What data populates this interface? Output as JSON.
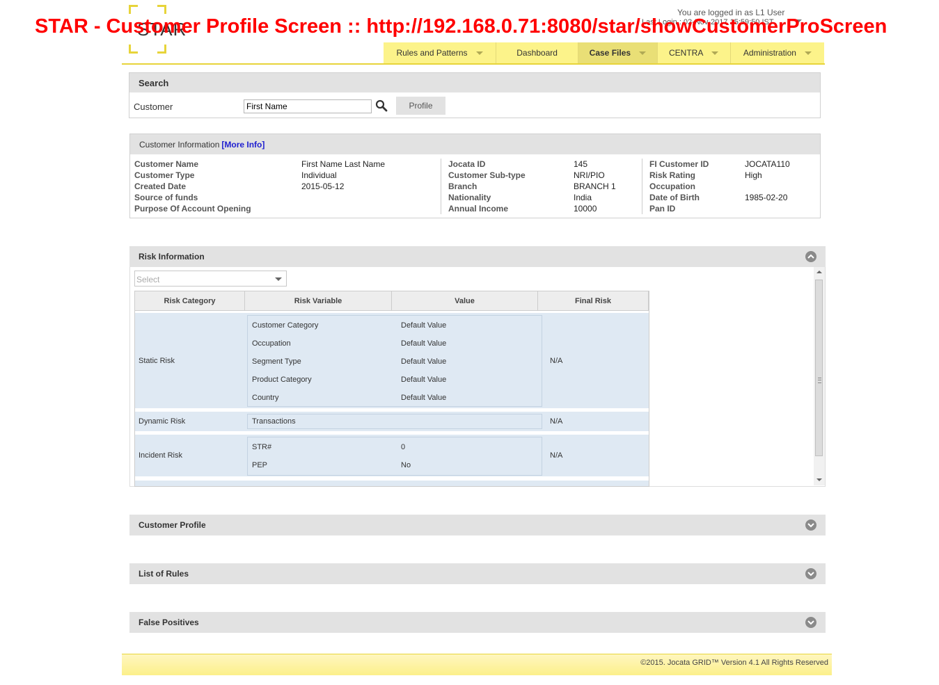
{
  "banner": "STAR - Customer Profile Screen :: http://192.168.0.71:8080/star/showCustomerProScreen",
  "logo_text": "STAR",
  "user": {
    "logged_in": "You are logged in as L1 User",
    "last_login": "Last Login : 02-Nov-2017 15:59:50 IST"
  },
  "nav": {
    "tabs": [
      {
        "label": "Rules and Patterns",
        "has_dropdown": true,
        "active": false
      },
      {
        "label": "Dashboard",
        "has_dropdown": false,
        "active": false
      },
      {
        "label": "Case Files",
        "has_dropdown": true,
        "active": true
      },
      {
        "label": "CENTRA",
        "has_dropdown": true,
        "active": false
      },
      {
        "label": "Administration",
        "has_dropdown": true,
        "active": false
      }
    ]
  },
  "search": {
    "title": "Search",
    "customer_label": "Customer",
    "input_value": "First Name",
    "profile_button": "Profile"
  },
  "customer_info": {
    "title": "Customer Information",
    "more_info": "[More Info]",
    "col1": [
      {
        "label": "Customer Name",
        "value": "First Name Last Name"
      },
      {
        "label": "Customer Type",
        "value": "Individual"
      },
      {
        "label": "Created Date",
        "value": "2015-05-12"
      },
      {
        "label": "Source of funds",
        "value": ""
      },
      {
        "label": "Purpose Of Account Opening",
        "value": ""
      }
    ],
    "col2": [
      {
        "label": "Jocata ID",
        "value": "145"
      },
      {
        "label": "Customer Sub-type",
        "value": "NRI/PIO"
      },
      {
        "label": "Branch",
        "value": "BRANCH 1"
      },
      {
        "label": "Nationality",
        "value": "India"
      },
      {
        "label": "Annual Income",
        "value": "10000"
      }
    ],
    "col3": [
      {
        "label": "FI Customer ID",
        "value": "JOCATA110"
      },
      {
        "label": "Risk Rating",
        "value": "High"
      },
      {
        "label": "Occupation",
        "value": ""
      },
      {
        "label": "Date of Birth",
        "value": "1985-02-20"
      },
      {
        "label": "Pan ID",
        "value": ""
      }
    ]
  },
  "risk": {
    "title": "Risk Information",
    "select_placeholder": "Select",
    "headers": [
      "Risk Category",
      "Risk Variable",
      "Value",
      "Final Risk"
    ],
    "static": {
      "category": "Static Risk",
      "final": "N/A",
      "rows": [
        {
          "variable": "Customer Category",
          "value": "Default Value"
        },
        {
          "variable": "Occupation",
          "value": "Default Value"
        },
        {
          "variable": "Segment Type",
          "value": "Default Value"
        },
        {
          "variable": "Product Category",
          "value": "Default Value"
        },
        {
          "variable": "Country",
          "value": "Default Value"
        }
      ]
    },
    "dynamic": {
      "category": "Dynamic Risk",
      "final": "N/A",
      "rows": [
        {
          "variable": "Transactions",
          "value": ""
        }
      ]
    },
    "incident": {
      "category": "Incident Risk",
      "final": "N/A",
      "rows": [
        {
          "variable": "STR#",
          "value": "0"
        },
        {
          "variable": "PEP",
          "value": "No"
        }
      ]
    }
  },
  "sections": {
    "customer_profile": "Customer Profile",
    "list_of_rules": "List of Rules",
    "false_positives": "False Positives"
  },
  "footer": "©2015. Jocata GRID™ Version 4.1 All Rights Reserved",
  "colors": {
    "banner_red": "#ff0000",
    "nav_yellow": "#fcf38a",
    "logo_yellow": "#e7d43a",
    "link_blue": "#2020d0"
  }
}
